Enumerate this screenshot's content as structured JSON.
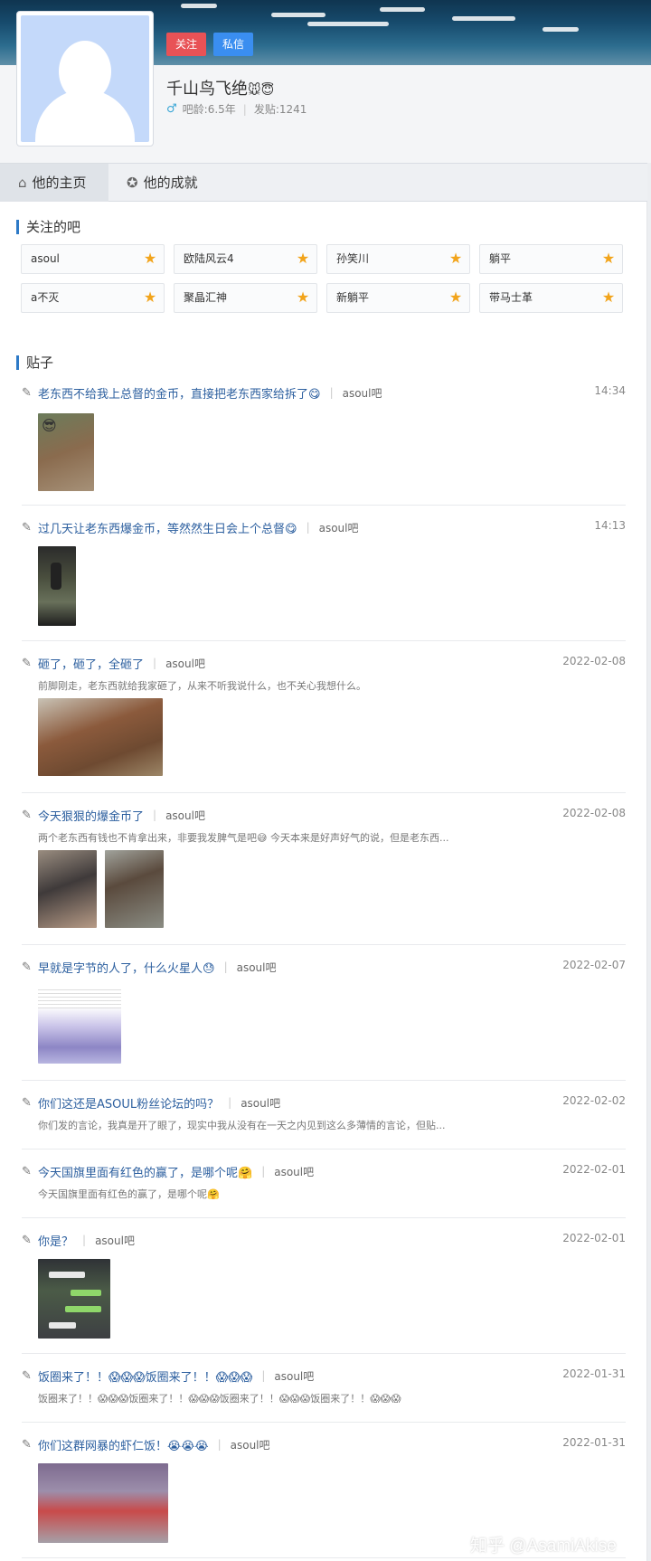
{
  "profile": {
    "name": "千山鸟飞绝",
    "name_emoji": "🐭😇",
    "follow_label": "关注",
    "message_label": "私信",
    "age": "吧龄:6.5年",
    "posts": "发贴:1241",
    "gender_icon": "male-icon"
  },
  "tabs": [
    {
      "label": "他的主页",
      "icon": "home-icon"
    },
    {
      "label": "他的成就",
      "icon": "medal-icon"
    }
  ],
  "followed_section": {
    "title": "关注的吧"
  },
  "bars": [
    "asoul",
    "欧陆风云4",
    "孙笑川",
    "躺平",
    "a不灭",
    "聚晶汇神",
    "新躺平",
    "带马士革"
  ],
  "posts_section": {
    "title": "贴子"
  },
  "posts": [
    {
      "title": "老东西不给我上总督的金币，直接把老东西家给拆了😋",
      "bar": "asoul吧",
      "time": "14:34",
      "abstract": ""
    },
    {
      "title": "过几天让老东西爆金币，等然然生日会上个总督😋",
      "bar": "asoul吧",
      "time": "14:13",
      "abstract": ""
    },
    {
      "title": "砸了，砸了，全砸了",
      "bar": "asoul吧",
      "time": "2022-02-08",
      "abstract": "前脚刚走，老东西就给我家砸了，从来不听我说什么，也不关心我想什么。"
    },
    {
      "title": "今天狠狠的爆金币了",
      "bar": "asoul吧",
      "time": "2022-02-08",
      "abstract": "两个老东西有钱也不肯拿出来，非要我发脾气是吧😅 今天本来是好声好气的说，但是老东西..."
    },
    {
      "title": "早就是字节的人了，什么火星人😓",
      "bar": "asoul吧",
      "time": "2022-02-07",
      "abstract": ""
    },
    {
      "title": "你们这还是ASOUL粉丝论坛的吗？",
      "bar": "asoul吧",
      "time": "2022-02-02",
      "abstract": "你们发的言论，我真是开了眼了，现实中我从没有在一天之内见到这么多薄情的言论，但贴..."
    },
    {
      "title": "今天国旗里面有红色的赢了，是哪个呢🤗",
      "bar": "asoul吧",
      "time": "2022-02-01",
      "abstract": "今天国旗里面有红色的赢了，是哪个呢🤗"
    },
    {
      "title": "你是？",
      "bar": "asoul吧",
      "time": "2022-02-01",
      "abstract": ""
    },
    {
      "title": "饭圈来了！！😱😱😱饭圈来了！！😱😱😱",
      "bar": "asoul吧",
      "time": "2022-01-31",
      "abstract": "饭圈来了！！😱😱😱饭圈来了！！😱😱😱饭圈来了！！😱😱😱饭圈来了！！😱😱😱"
    },
    {
      "title": "你们这群网暴的虾仁饭！😭😭😭",
      "bar": "asoul吧",
      "time": "2022-01-31",
      "abstract": ""
    }
  ],
  "watermark": "知乎 @AsamiAkise",
  "colors": {
    "link": "#2c5f9f",
    "follow": "#e85256",
    "message": "#3a8ef0",
    "accent": "#2d7ac7",
    "star": "#f2a41b"
  }
}
